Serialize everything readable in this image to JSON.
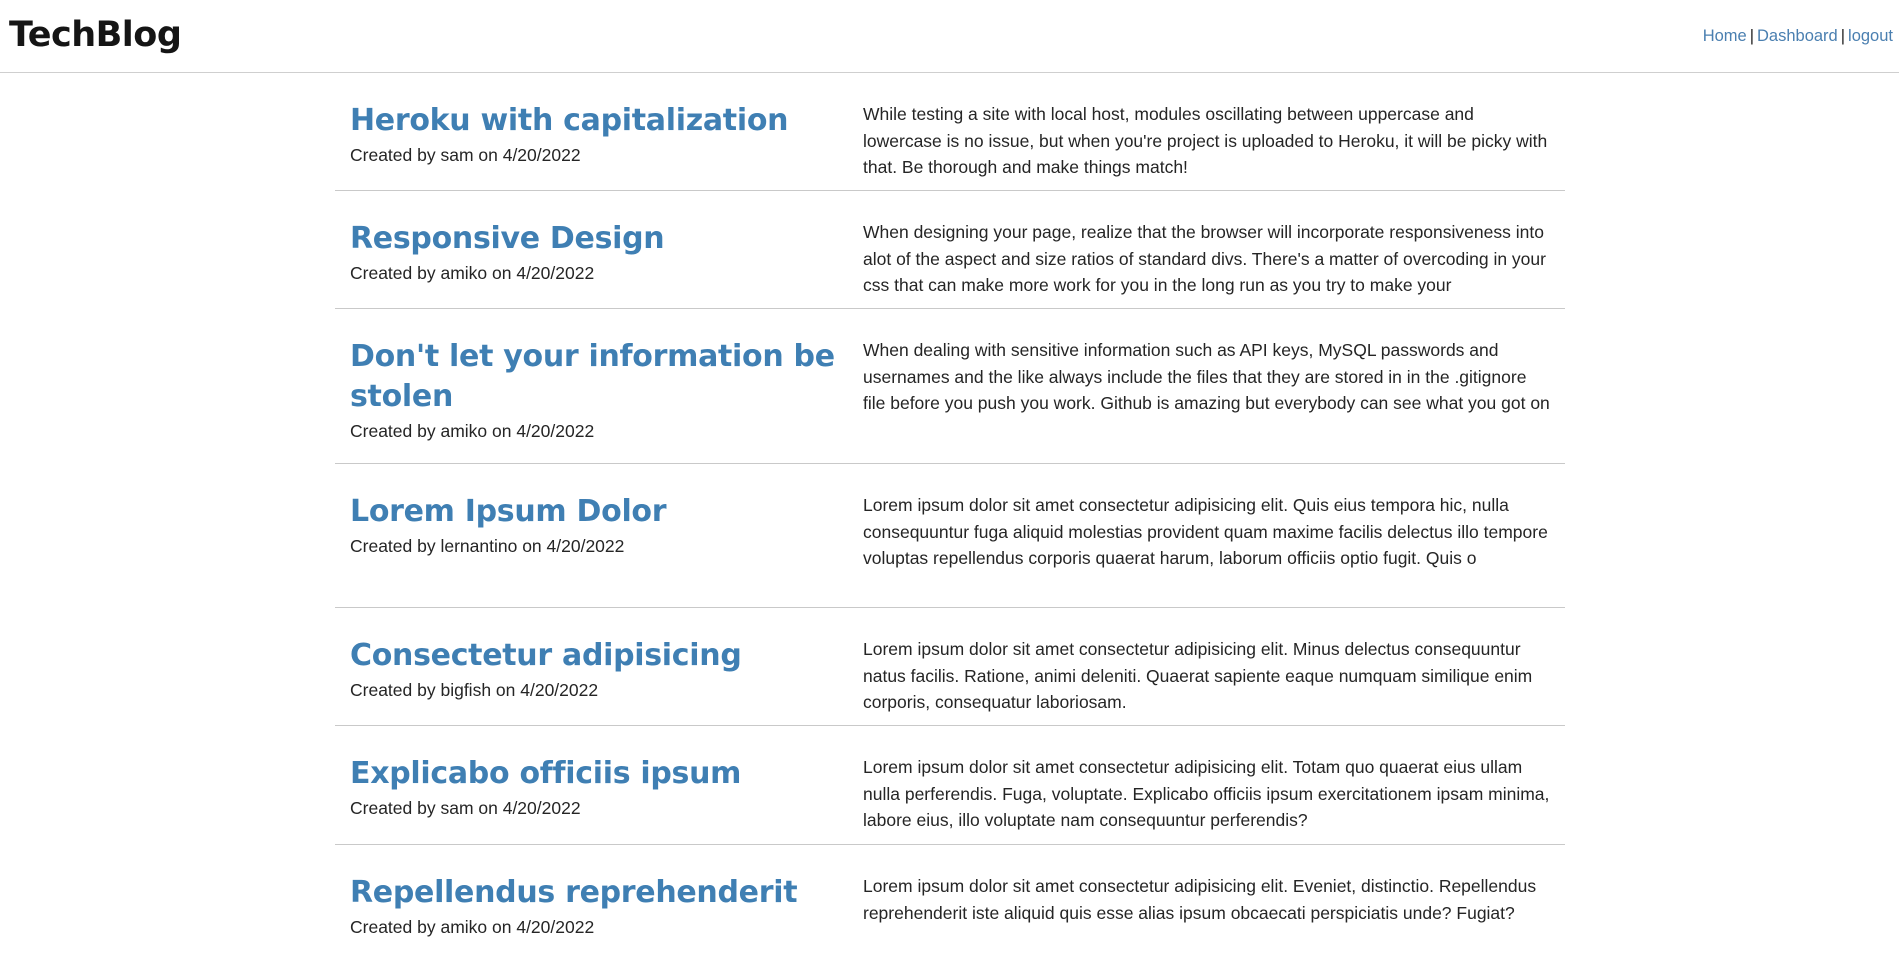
{
  "header": {
    "brand": "TechBlog",
    "nav": {
      "home": "Home",
      "dashboard": "Dashboard",
      "logout": "logout",
      "separator": "|"
    }
  },
  "posts": [
    {
      "title": "Heroku with capitalization",
      "author": "sam",
      "date": "4/20/2022",
      "meta": "Created by sam on 4/20/2022",
      "excerpt": "While testing a site with local host, modules oscillating between uppercase and lowercase is no issue, but when you're project is uploaded to Heroku, it will be picky with that. Be thorough and make things match!"
    },
    {
      "title": "Responsive Design",
      "author": "amiko",
      "date": "4/20/2022",
      "meta": "Created by amiko on 4/20/2022",
      "excerpt": "When designing your page, realize that the browser will incorporate responsiveness into alot of the aspect and size ratios of standard divs. There's a matter of overcoding in your css that can make more work for you in the long run as you try to make your"
    },
    {
      "title": "Don't let your information be stolen",
      "author": "amiko",
      "date": "4/20/2022",
      "meta": "Created by amiko on 4/20/2022",
      "excerpt": "When dealing with sensitive information such as API keys, MySQL passwords and usernames and the like always include the files that they are stored in in the .gitignore file before you push you work. Github is amazing but everybody can see what you got on"
    },
    {
      "title": "Lorem Ipsum Dolor",
      "author": "lernantino",
      "date": "4/20/2022",
      "meta": "Created by lernantino on 4/20/2022",
      "excerpt": "Lorem ipsum dolor sit amet consectetur adipisicing elit. Quis eius tempora hic, nulla consequuntur fuga aliquid molestias provident quam maxime facilis delectus illo tempore voluptas repellendus corporis quaerat harum, laborum officiis optio fugit. Quis o"
    },
    {
      "title": "Consectetur adipisicing",
      "author": "bigfish",
      "date": "4/20/2022",
      "meta": "Created by bigfish on 4/20/2022",
      "excerpt": "Lorem ipsum dolor sit amet consectetur adipisicing elit. Minus delectus consequuntur natus facilis. Ratione, animi deleniti. Quaerat sapiente eaque numquam similique enim corporis, consequatur laboriosam."
    },
    {
      "title": "Explicabo officiis ipsum",
      "author": "sam",
      "date": "4/20/2022",
      "meta": "Created by sam on 4/20/2022",
      "excerpt": "Lorem ipsum dolor sit amet consectetur adipisicing elit. Totam quo quaerat eius ullam nulla perferendis. Fuga, voluptate. Explicabo officiis ipsum exercitationem ipsam minima, labore eius, illo voluptate nam consequuntur perferendis?"
    },
    {
      "title": "Repellendus reprehenderit",
      "author": "amiko",
      "date": "4/20/2022",
      "meta": "Created by amiko on 4/20/2022",
      "excerpt": "Lorem ipsum dolor sit amet consectetur adipisicing elit. Eveniet, distinctio. Repellendus reprehenderit iste aliquid quis esse alias ipsum obcaecati perspiciatis unde? Fugiat?"
    }
  ],
  "colors": {
    "link": "#3f7fb3",
    "nav_link": "#4a7fb0",
    "divider": "#c9c9c9",
    "text": "#252525"
  }
}
